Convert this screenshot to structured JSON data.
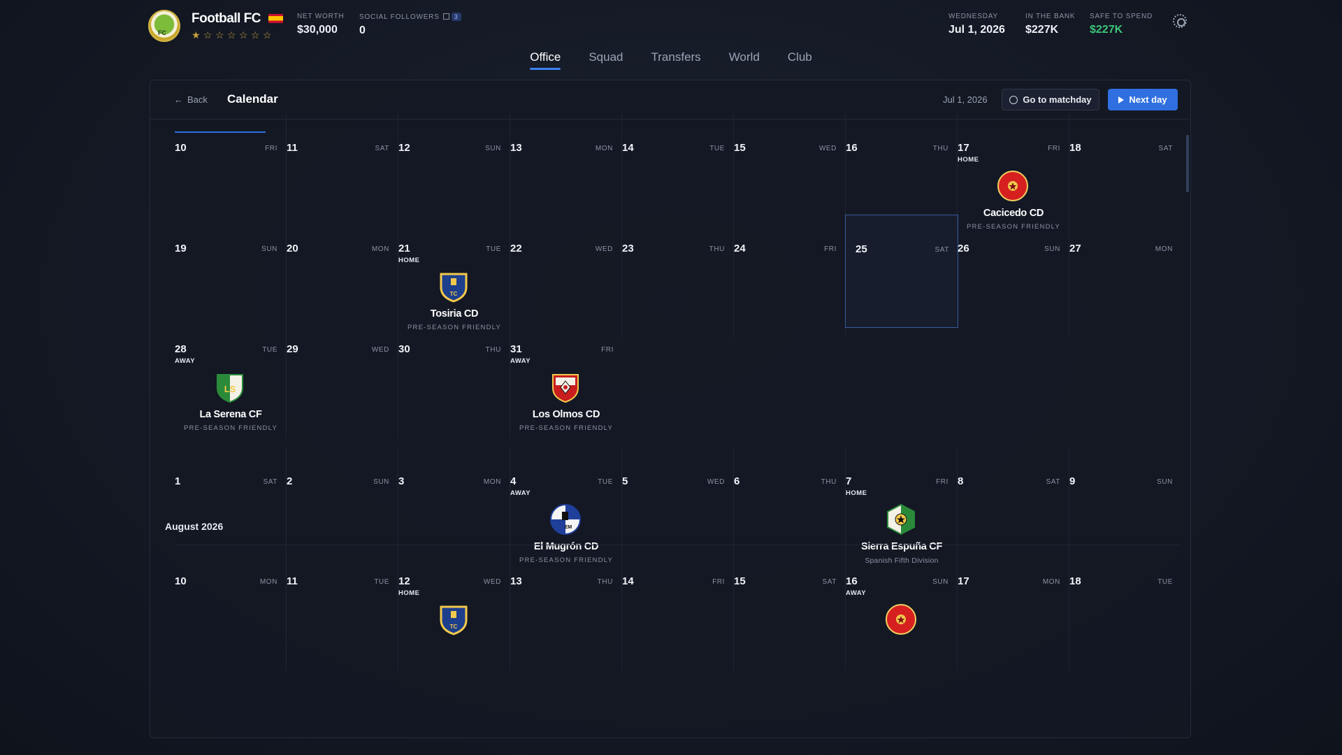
{
  "header": {
    "club_name": "Football FC",
    "flag_icon": "spain-flag-icon",
    "stars": [
      "half",
      "empty",
      "empty",
      "empty",
      "empty",
      "empty",
      "empty"
    ],
    "net_worth_label": "NET WORTH",
    "net_worth_value": "$30,000",
    "social_label": "SOCIAL FOLLOWERS",
    "social_badge": "3",
    "social_value": "0",
    "date_label": "WEDNESDAY",
    "date_value": "Jul 1, 2026",
    "bank_label": "IN THE BANK",
    "bank_value": "$227K",
    "safe_label": "SAFE TO SPEND",
    "safe_value": "$227K",
    "accent_green": "#3ec47a"
  },
  "nav": {
    "tabs": [
      "Office",
      "Squad",
      "Transfers",
      "World",
      "Club"
    ],
    "active": "Office"
  },
  "panel": {
    "back_label": "Back",
    "title": "Calendar",
    "current_date": "Jul 1, 2026",
    "matchday_label": "Go to matchday",
    "next_label": "Next day"
  },
  "calendar": {
    "august_label": "August 2026",
    "weeks": [
      {
        "days": [
          {
            "num": "10",
            "wd": "FRI"
          },
          {
            "num": "11",
            "wd": "SAT"
          },
          {
            "num": "12",
            "wd": "SUN"
          },
          {
            "num": "13",
            "wd": "MON"
          },
          {
            "num": "14",
            "wd": "TUE"
          },
          {
            "num": "15",
            "wd": "WED"
          },
          {
            "num": "16",
            "wd": "THU"
          },
          {
            "num": "17",
            "wd": "FRI",
            "venue": "HOME",
            "opp": "Cacicedo CD",
            "comp": "PRE-SEASON FRIENDLY",
            "crest": "red-circle"
          },
          {
            "num": "18",
            "wd": "SAT"
          }
        ]
      },
      {
        "days": [
          {
            "num": "19",
            "wd": "SUN"
          },
          {
            "num": "20",
            "wd": "MON"
          },
          {
            "num": "21",
            "wd": "TUE",
            "venue": "HOME",
            "opp": "Tosiria CD",
            "comp": "PRE-SEASON FRIENDLY",
            "crest": "blue-shield"
          },
          {
            "num": "22",
            "wd": "WED"
          },
          {
            "num": "23",
            "wd": "THU"
          },
          {
            "num": "24",
            "wd": "FRI"
          },
          {
            "num": "25",
            "wd": "SAT",
            "today": true
          },
          {
            "num": "26",
            "wd": "SUN"
          },
          {
            "num": "27",
            "wd": "MON"
          }
        ]
      },
      {
        "days": [
          {
            "num": "28",
            "wd": "TUE",
            "venue": "AWAY",
            "opp": "La Serena CF",
            "comp": "PRE-SEASON FRIENDLY",
            "crest": "green-shield"
          },
          {
            "num": "29",
            "wd": "WED"
          },
          {
            "num": "30",
            "wd": "THU"
          },
          {
            "num": "31",
            "wd": "FRI",
            "venue": "AWAY",
            "opp": "Los Olmos CD",
            "comp": "PRE-SEASON FRIENDLY",
            "crest": "redwhite-shield"
          }
        ]
      },
      {
        "days": [
          {
            "num": "1",
            "wd": "SAT"
          },
          {
            "num": "2",
            "wd": "SUN"
          },
          {
            "num": "3",
            "wd": "MON"
          },
          {
            "num": "4",
            "wd": "TUE",
            "venue": "AWAY",
            "opp": "El Mugrón CD",
            "comp": "PRE-SEASON FRIENDLY",
            "crest": "bluewhite-circle"
          },
          {
            "num": "5",
            "wd": "WED"
          },
          {
            "num": "6",
            "wd": "THU"
          },
          {
            "num": "7",
            "wd": "FRI",
            "venue": "HOME",
            "opp": "Sierra Espuña CF",
            "comp": "Spanish Fifth Division",
            "crest": "green-hex"
          },
          {
            "num": "8",
            "wd": "SAT"
          },
          {
            "num": "9",
            "wd": "SUN"
          }
        ]
      },
      {
        "days": [
          {
            "num": "10",
            "wd": "MON"
          },
          {
            "num": "11",
            "wd": "TUE"
          },
          {
            "num": "12",
            "wd": "WED",
            "venue": "HOME",
            "crest": "blue-shield"
          },
          {
            "num": "13",
            "wd": "THU"
          },
          {
            "num": "14",
            "wd": "FRI"
          },
          {
            "num": "15",
            "wd": "SAT"
          },
          {
            "num": "16",
            "wd": "SUN",
            "venue": "AWAY",
            "crest": "red-circle"
          },
          {
            "num": "17",
            "wd": "MON"
          },
          {
            "num": "18",
            "wd": "TUE"
          }
        ]
      }
    ]
  }
}
